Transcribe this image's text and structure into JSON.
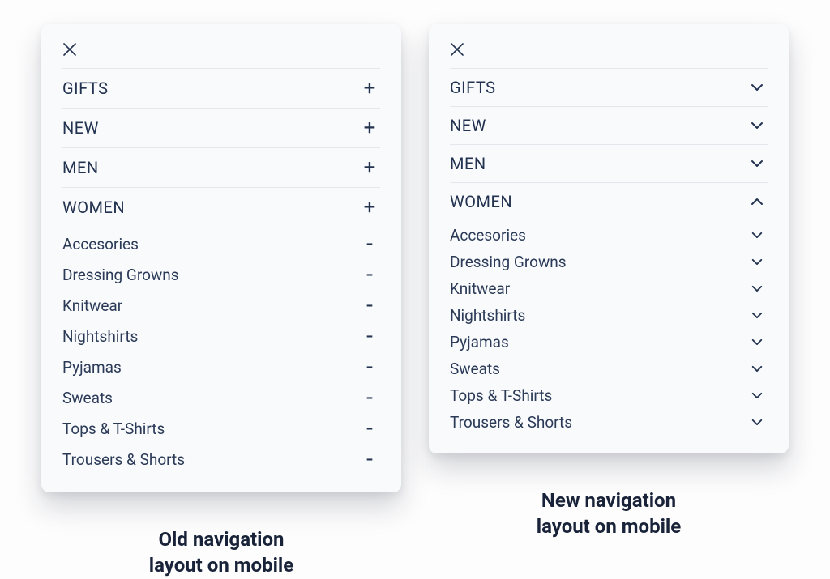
{
  "captions": {
    "old": {
      "line1": "Old navigation",
      "line2": "layout on mobile"
    },
    "new": {
      "line1": "New navigation",
      "line2": "layout on mobile"
    }
  },
  "mainCategories": [
    {
      "label": "GIFTS",
      "oldState": "collapsed",
      "newState": "collapsed"
    },
    {
      "label": "NEW",
      "oldState": "collapsed",
      "newState": "collapsed"
    },
    {
      "label": "MEN",
      "oldState": "collapsed",
      "newState": "collapsed"
    },
    {
      "label": "WOMEN",
      "oldState": "expanded",
      "newState": "expanded"
    }
  ],
  "subCategories": [
    {
      "label": "Accesories"
    },
    {
      "label": "Dressing Growns"
    },
    {
      "label": "Knitwear"
    },
    {
      "label": "Nightshirts"
    },
    {
      "label": "Pyjamas"
    },
    {
      "label": "Sweats"
    },
    {
      "label": "Tops & T-Shirts"
    },
    {
      "label": "Trousers & Shorts"
    }
  ],
  "icons": {
    "plus": "+",
    "minus": "-"
  },
  "colors": {
    "text": "#22324f",
    "panelBg": "#f8fafc",
    "divider": "#e4e7ee"
  }
}
